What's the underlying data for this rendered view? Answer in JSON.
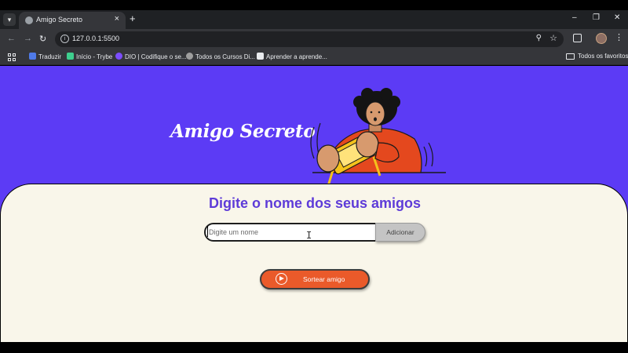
{
  "browser": {
    "tab_title": "Amigo Secreto",
    "tab_close": "×",
    "new_tab": "+",
    "window_controls": [
      "–",
      "❐",
      "✕"
    ],
    "url": "127.0.0.1:5500",
    "nav": {
      "back": "←",
      "forward": "→",
      "reload": "↻"
    },
    "bookmarks": [
      {
        "label": "Traduzir",
        "color": "#4f7ae8"
      },
      {
        "label": "Início - Trybe",
        "color": "#3ecf8e"
      },
      {
        "label": "DIO | Codifique o se...",
        "color": "#7c4dff"
      },
      {
        "label": "Todos os Cursos Di...",
        "color": "#9e9e9e"
      },
      {
        "label": "Aprender a aprende...",
        "color": "#e8eaed"
      }
    ],
    "favorites_label": "Todos os favoritos"
  },
  "page": {
    "hero_title": "Amigo Secreto",
    "subtitle": "Digite o nome dos seus amigos",
    "input_placeholder": "Digite um nome",
    "input_value": "",
    "add_label": "Adicionar",
    "draw_label": "Sortear amigo"
  },
  "colors": {
    "hero_bg": "#5c3bf5",
    "card_bg": "#f9f6ea",
    "subtitle": "#5e3bd8",
    "draw_button": "#ea5a2a",
    "add_button": "#c4c4c4"
  }
}
